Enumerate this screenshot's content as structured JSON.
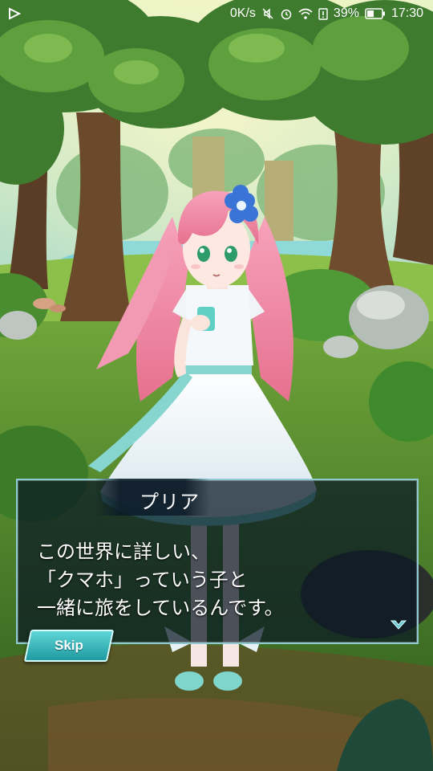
{
  "status_bar": {
    "network_speed": "0K/s",
    "battery_percent": "39%",
    "time": "17:30",
    "icons": [
      "notification-icon",
      "mute-icon",
      "alarm-icon",
      "wifi-icon",
      "battery-alert-icon",
      "battery-icon"
    ]
  },
  "dialog": {
    "speaker_name": "プリア",
    "lines": [
      "この世界に詳しい、",
      "「クマホ」っていう子と",
      "一緒に旅をしているんです。"
    ],
    "next_icon": "chevron-down-icon"
  },
  "skip_button": {
    "label": "Skip"
  },
  "colors": {
    "dialog_border": "#8fc9d2",
    "skip_button": "#1f9aa2",
    "character_hair": "#f08aa8",
    "flower": "#3a74d6"
  }
}
